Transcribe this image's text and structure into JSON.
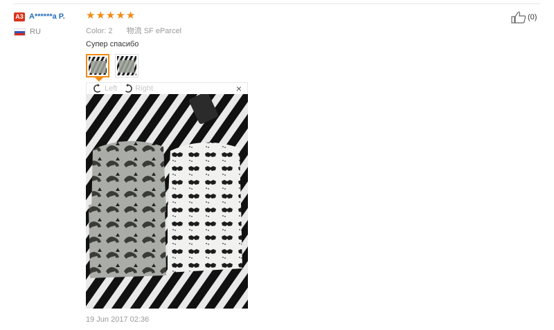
{
  "reviewer": {
    "badge": "A3",
    "name": "A******a P.",
    "country_code": "RU",
    "flag_icon": "russia-flag-icon"
  },
  "review": {
    "rating": 5,
    "stars": [
      "★",
      "★",
      "★",
      "★",
      "★"
    ],
    "color_label": "Color:",
    "color_value": "2",
    "shipping_label": "物流",
    "shipping_value": "SF eParcel",
    "text": "Супер спасибо",
    "date": "19 Jun 2017 02:36",
    "photo_count": 2
  },
  "viewer": {
    "rotate_left_label": "Left",
    "rotate_right_label": "Right",
    "close_symbol": "×"
  },
  "helpful": {
    "count_label": "(0)",
    "icon": "thumbs-up-icon"
  },
  "colors": {
    "accent": "#f28b15",
    "username": "#2a6ebb",
    "badge": "#d9331a"
  }
}
